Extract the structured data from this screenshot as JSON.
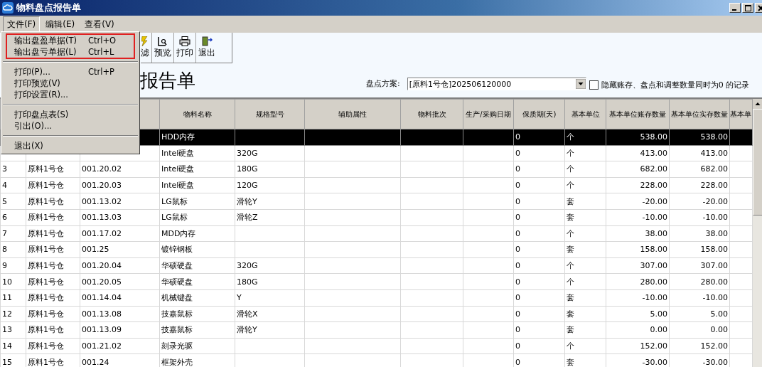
{
  "window": {
    "title": "物料盘点报告单"
  },
  "menu_bar": [
    {
      "label": "文件(F)",
      "selected": true
    },
    {
      "label": "编辑(E)",
      "selected": false
    },
    {
      "label": "查看(V)",
      "selected": false
    }
  ],
  "open_menu": {
    "groups": [
      {
        "highlighted": true,
        "items": [
          {
            "label": "输出盘盈单据(T)",
            "shortcut": "Ctrl+O"
          },
          {
            "label": "输出盘亏单据(L)",
            "shortcut": "Ctrl+L"
          }
        ]
      },
      {
        "highlighted": false,
        "items": [
          {
            "label": "打印(P)...",
            "shortcut": "Ctrl+P"
          },
          {
            "label": "打印预览(V)"
          },
          {
            "label": "打印设置(R)..."
          }
        ]
      },
      {
        "highlighted": false,
        "items": [
          {
            "label": "打印盘点表(S)"
          },
          {
            "label": "引出(O)..."
          }
        ]
      },
      {
        "highlighted": false,
        "items": [
          {
            "label": "退出(X)"
          }
        ]
      }
    ]
  },
  "toolbar": [
    {
      "kind": "filter",
      "label": "滤"
    },
    {
      "kind": "preview",
      "label": "预览"
    },
    {
      "kind": "print",
      "label": "打印"
    },
    {
      "kind": "exit",
      "label": "退出"
    }
  ],
  "report_title": "报告单",
  "plan": {
    "label": "盘点方案:",
    "value": "[原料1号仓]202506120000"
  },
  "hide_zero": {
    "label": "隐藏账存、盘点和调整数量同时为0 的记录",
    "checked": false
  },
  "table": {
    "columns": [
      "物料名称",
      "规格型号",
      "辅助属性",
      "物料批次",
      "生产/采购日期",
      "保质期(天)",
      "基本单位",
      "基本单位账存数量",
      "基本单位实存数量",
      "基本单"
    ],
    "rows": [
      {
        "selected": true,
        "name": "HDD内存",
        "shelf": "0",
        "unit": "个",
        "book": "538.00",
        "actual": "538.00"
      },
      {
        "selected": false,
        "name": "Intel硬盘",
        "spec": "320G",
        "shelf": "0",
        "unit": "个",
        "book": "413.00",
        "actual": "413.00"
      },
      {
        "selected": false,
        "no": "3",
        "warehouse": "原料1号仓",
        "code": "001.20.02",
        "name": "Intel硬盘",
        "spec": "180G",
        "shelf": "0",
        "unit": "个",
        "book": "682.00",
        "actual": "682.00"
      },
      {
        "selected": false,
        "no": "4",
        "warehouse": "原料1号仓",
        "code": "001.20.03",
        "name": "Intel硬盘",
        "spec": "120G",
        "shelf": "0",
        "unit": "个",
        "book": "228.00",
        "actual": "228.00"
      },
      {
        "selected": false,
        "no": "5",
        "warehouse": "原料1号仓",
        "code": "001.13.02",
        "name": "LG鼠标",
        "spec": "滑轮Y",
        "shelf": "0",
        "unit": "套",
        "book": "-20.00",
        "actual": "-20.00"
      },
      {
        "selected": false,
        "no": "6",
        "warehouse": "原料1号仓",
        "code": "001.13.03",
        "name": "LG鼠标",
        "spec": "滑轮Z",
        "shelf": "0",
        "unit": "套",
        "book": "-10.00",
        "actual": "-10.00"
      },
      {
        "selected": false,
        "no": "7",
        "warehouse": "原料1号仓",
        "code": "001.17.02",
        "name": "MDD内存",
        "shelf": "0",
        "unit": "个",
        "book": "38.00",
        "actual": "38.00"
      },
      {
        "selected": false,
        "no": "8",
        "warehouse": "原料1号仓",
        "code": "001.25",
        "name": "镀锌钢板",
        "shelf": "0",
        "unit": "套",
        "book": "158.00",
        "actual": "158.00"
      },
      {
        "selected": false,
        "no": "9",
        "warehouse": "原料1号仓",
        "code": "001.20.04",
        "name": "华硕硬盘",
        "spec": "320G",
        "shelf": "0",
        "unit": "个",
        "book": "307.00",
        "actual": "307.00"
      },
      {
        "selected": false,
        "no": "10",
        "warehouse": "原料1号仓",
        "code": "001.20.05",
        "name": "华硕硬盘",
        "spec": "180G",
        "shelf": "0",
        "unit": "个",
        "book": "280.00",
        "actual": "280.00"
      },
      {
        "selected": false,
        "no": "11",
        "warehouse": "原料1号仓",
        "code": "001.14.04",
        "name": "机械键盘",
        "spec": "Y",
        "shelf": "0",
        "unit": "套",
        "book": "-10.00",
        "actual": "-10.00"
      },
      {
        "selected": false,
        "no": "12",
        "warehouse": "原料1号仓",
        "code": "001.13.08",
        "name": "技嘉鼠标",
        "spec": "滑轮X",
        "shelf": "0",
        "unit": "套",
        "book": "5.00",
        "actual": "5.00"
      },
      {
        "selected": false,
        "no": "13",
        "warehouse": "原料1号仓",
        "code": "001.13.09",
        "name": "技嘉鼠标",
        "spec": "滑轮Y",
        "shelf": "0",
        "unit": "套",
        "book": "0.00",
        "actual": "0.00"
      },
      {
        "selected": false,
        "no": "14",
        "warehouse": "原料1号仓",
        "code": "001.21.02",
        "name": "刻录光驱",
        "shelf": "0",
        "unit": "个",
        "book": "152.00",
        "actual": "152.00"
      },
      {
        "selected": false,
        "no": "15",
        "warehouse": "原料1号仓",
        "code": "001.24",
        "name": "框架外壳",
        "shelf": "0",
        "unit": "套",
        "book": "-30.00",
        "actual": "-30.00"
      }
    ]
  }
}
